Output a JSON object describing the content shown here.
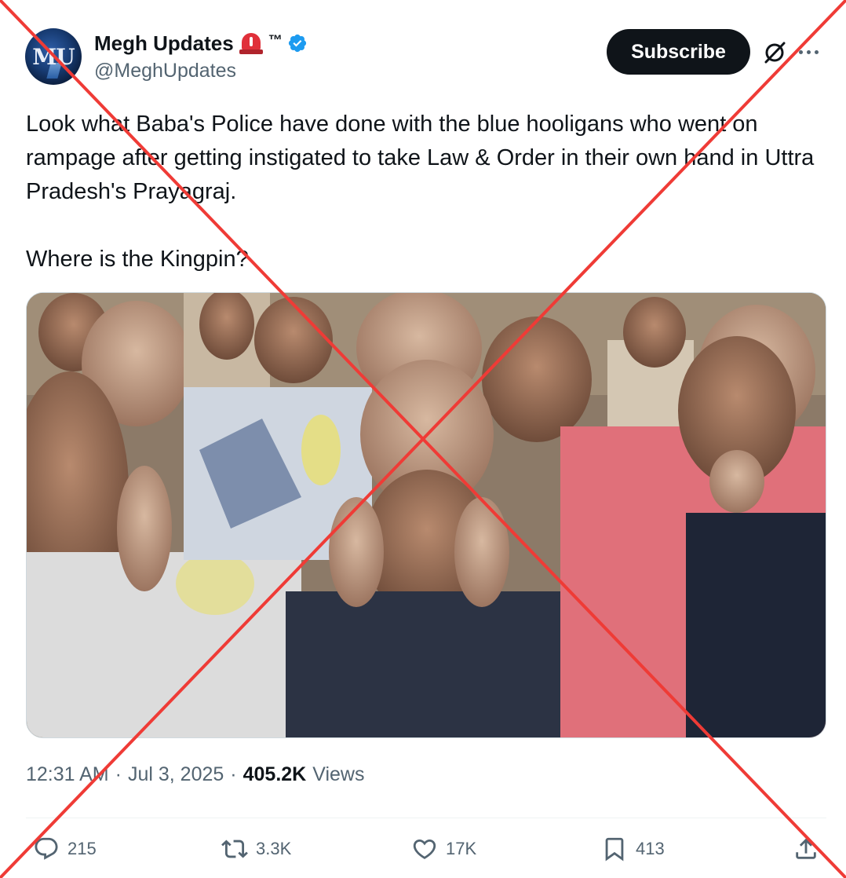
{
  "author": {
    "display_name": "Megh Updates",
    "emoji_siren": "🚨",
    "tm": "™",
    "handle": "@MeghUpdates",
    "avatar_text": "MU",
    "verified": true
  },
  "header": {
    "subscribe_label": "Subscribe",
    "icons": [
      "grok-icon",
      "more-icon"
    ]
  },
  "tweet": {
    "text_p1": "Look what Baba's Police have done with the blue hooligans who went on rampage after getting instigated to take Law & Order in their own hand in Uttra Pradesh's Prayagraj.",
    "text_p2": "Where is the Kingpin?"
  },
  "meta": {
    "time": "12:31 AM",
    "separator": "·",
    "date": "Jul 3, 2025",
    "views_count": "405.2K",
    "views_label": "Views"
  },
  "actions": {
    "replies": "215",
    "reposts": "3.3K",
    "likes": "17K",
    "bookmarks": "413"
  },
  "colors": {
    "text": "#0f1419",
    "secondary": "#536471",
    "verified": "#1d9bf0",
    "button_bg": "#0f1419",
    "cross": "#ef3b36"
  }
}
